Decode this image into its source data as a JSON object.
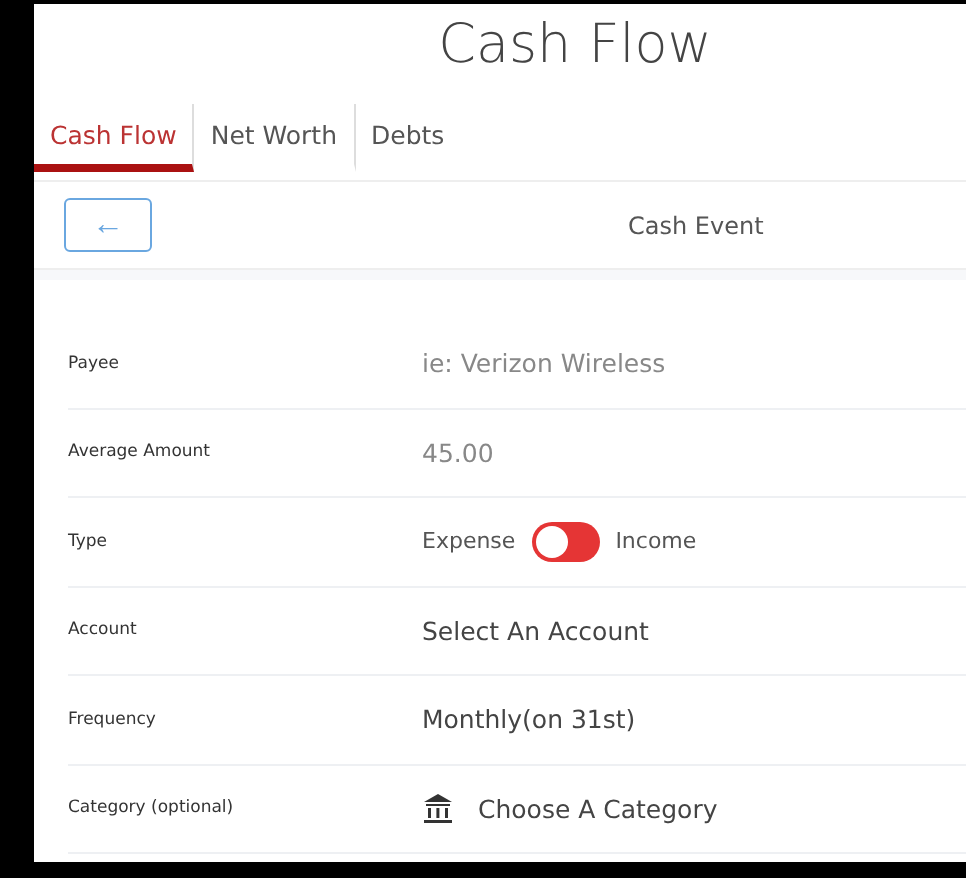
{
  "page_title": "Cash Flow",
  "tabs": [
    {
      "label": "Cash Flow",
      "selected": true
    },
    {
      "label": "Net Worth",
      "selected": false
    },
    {
      "label": "Debts",
      "selected": false
    }
  ],
  "toolbar": {
    "back_icon": "←",
    "title": "Cash Event"
  },
  "form": [
    {
      "kind": "input",
      "label": "Payee",
      "placeholder": "ie: Verizon Wireless"
    },
    {
      "kind": "input",
      "label": "Average Amount",
      "placeholder": "45.00"
    },
    {
      "kind": "toggle",
      "label": "Type",
      "left_label": "Expense",
      "right_label": "Income",
      "on": false
    },
    {
      "kind": "select",
      "label": "Account",
      "value": "Select An Account"
    },
    {
      "kind": "select",
      "label": "Frequency",
      "value": "Monthly(on 31st)"
    },
    {
      "kind": "category",
      "label": "Category (optional)",
      "value": "Choose A Category"
    }
  ]
}
